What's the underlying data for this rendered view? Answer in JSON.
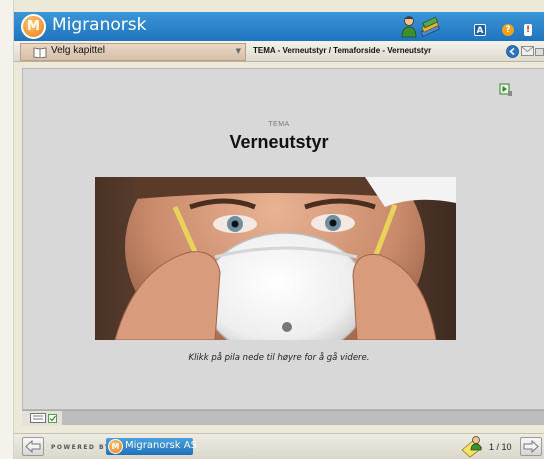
{
  "app": {
    "title": "Migranorsk",
    "logo_letter": "M"
  },
  "header": {
    "icons": [
      "learners-icon",
      "books-icon"
    ],
    "buttons": [
      {
        "name": "font-button",
        "label": "A",
        "color": "#ffffff",
        "bg": "#1d5fa6"
      },
      {
        "name": "help-button",
        "label": "?",
        "color": "#ffffff",
        "bg": "#f2a21b"
      },
      {
        "name": "info-button",
        "label": "!",
        "color": "#c0392b",
        "bg": "#ffffff"
      }
    ]
  },
  "navbar": {
    "chapter_select_value": "Velg kapittel",
    "breadcrumb": "TEMA - Verneutstyr / Temaforside - Verneutstyr"
  },
  "content": {
    "kicker": "TEMA",
    "title": "Verneutstyr",
    "image_subject": "worker-wearing-dust-mask",
    "caption": "Klikk på pila nede til høyre for å gå videre."
  },
  "footer": {
    "powered_by": "POWERED BY",
    "brand": "Migranorsk AS",
    "page_counter": "1 / 10"
  },
  "colors": {
    "header_blue": "#2a84cf",
    "content_gray": "#d8d8d8",
    "chapter_tan": "#dcc5af",
    "brand_orange": "#f07a12"
  }
}
